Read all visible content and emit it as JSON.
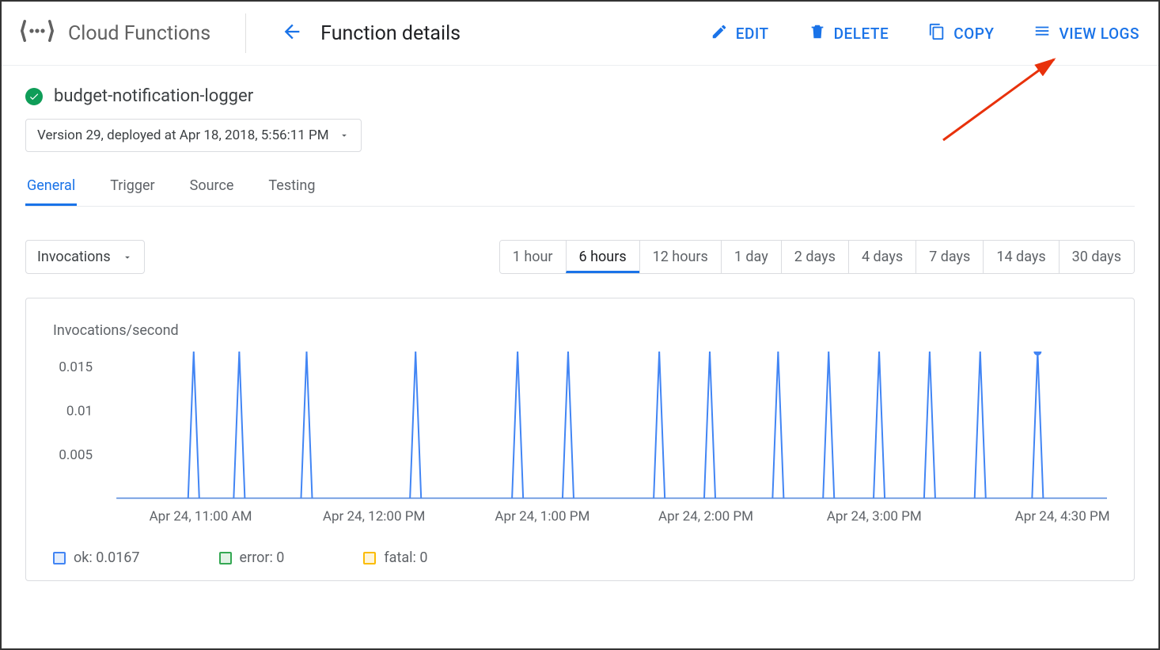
{
  "header": {
    "product": "Cloud Functions",
    "page_title": "Function details",
    "actions": {
      "edit": "EDIT",
      "delete": "DELETE",
      "copy": "COPY",
      "view_logs": "VIEW LOGS"
    }
  },
  "function": {
    "name": "budget-notification-logger",
    "version_label": "Version 29, deployed at Apr 18, 2018, 5:56:11 PM"
  },
  "tabs": [
    {
      "id": "general",
      "label": "General",
      "active": true
    },
    {
      "id": "trigger",
      "label": "Trigger",
      "active": false
    },
    {
      "id": "source",
      "label": "Source",
      "active": false
    },
    {
      "id": "testing",
      "label": "Testing",
      "active": false
    }
  ],
  "metric_select": "Invocations",
  "time_range": [
    {
      "label": "1 hour",
      "active": false
    },
    {
      "label": "6 hours",
      "active": true
    },
    {
      "label": "12 hours",
      "active": false
    },
    {
      "label": "1 day",
      "active": false
    },
    {
      "label": "2 days",
      "active": false
    },
    {
      "label": "4 days",
      "active": false
    },
    {
      "label": "7 days",
      "active": false
    },
    {
      "label": "14 days",
      "active": false
    },
    {
      "label": "30 days",
      "active": false
    }
  ],
  "chart_title": "Invocations/second",
  "chart_data": {
    "type": "line",
    "title": "Invocations/second",
    "xlabel": "",
    "ylabel": "Invocations/second",
    "ylim": [
      0,
      0.0167
    ],
    "y_ticks": [
      0.005,
      0.01,
      0.015
    ],
    "x_tick_labels": [
      "Apr 24, 11:00 AM",
      "Apr 24, 12:00 PM",
      "Apr 24, 1:00 PM",
      "Apr 24, 2:00 PM",
      "Apr 24, 3:00 PM",
      "Apr 24, 4:30 PM"
    ],
    "series": [
      {
        "name": "ok",
        "color": "#4285f4",
        "peak_value": 0.0167,
        "baseline": 0,
        "spike_positions_pct": [
          7.8,
          12.4,
          19.2,
          30.2,
          40.5,
          45.6,
          54.8,
          59.9,
          66.8,
          71.9,
          77.0,
          82.1,
          87.2,
          93.0
        ]
      },
      {
        "name": "error",
        "color": "#34a853",
        "peak_value": 0
      },
      {
        "name": "fatal",
        "color": "#fbbc05",
        "peak_value": 0
      }
    ]
  },
  "legend": {
    "ok": "ok: 0.0167",
    "error": "error: 0",
    "fatal": "fatal: 0"
  }
}
